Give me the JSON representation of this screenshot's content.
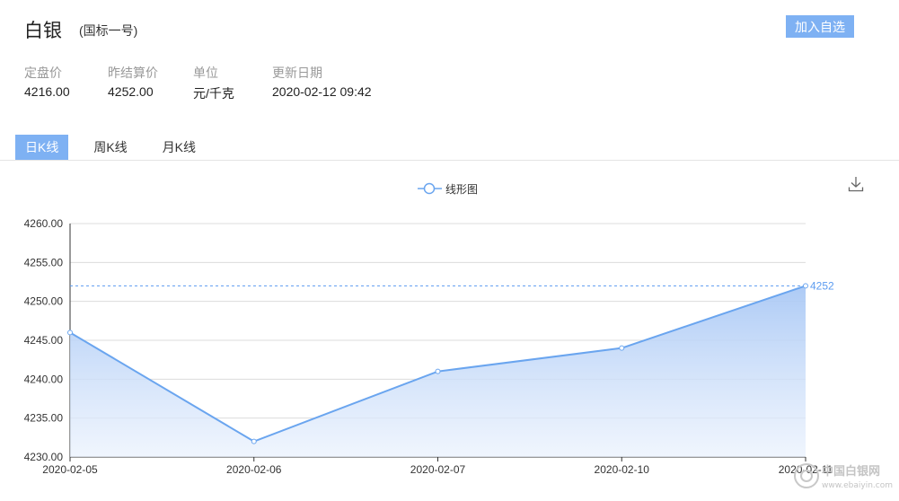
{
  "header": {
    "title": "白银",
    "subtitle": "(国标一号)",
    "add_button": "加入自选"
  },
  "info": [
    {
      "label": "定盘价",
      "value": "4216.00"
    },
    {
      "label": "昨结算价",
      "value": "4252.00"
    },
    {
      "label": "单位",
      "value": "元/千克"
    },
    {
      "label": "更新日期",
      "value": "2020-02-12 09:42"
    }
  ],
  "tabs": [
    {
      "label": "日K线",
      "active": true
    },
    {
      "label": "周K线",
      "active": false
    },
    {
      "label": "月K线",
      "active": false
    }
  ],
  "toolbox": {
    "icon": "download-icon"
  },
  "watermark": {
    "name": "中国白银网",
    "url": "www.ebaiyin.com"
  },
  "colors": {
    "accent": "#7eb1f3",
    "line": "#6aa5ef",
    "markline": "#5b9bf0"
  },
  "chart_data": {
    "type": "area",
    "categories": [
      "2020-02-05",
      "2020-02-06",
      "2020-02-07",
      "2020-02-10",
      "2020-02-11"
    ],
    "series": [
      {
        "name": "线形图",
        "values": [
          4246,
          4232,
          4241,
          4244,
          4252
        ]
      }
    ],
    "ylim": [
      4230,
      4260
    ],
    "yticks": [
      "4230.00",
      "4235.00",
      "4240.00",
      "4245.00",
      "4250.00",
      "4255.00",
      "4260.00"
    ],
    "markline": {
      "value": 4252,
      "label": "4252"
    },
    "legend_position": "top-center",
    "grid": true
  }
}
